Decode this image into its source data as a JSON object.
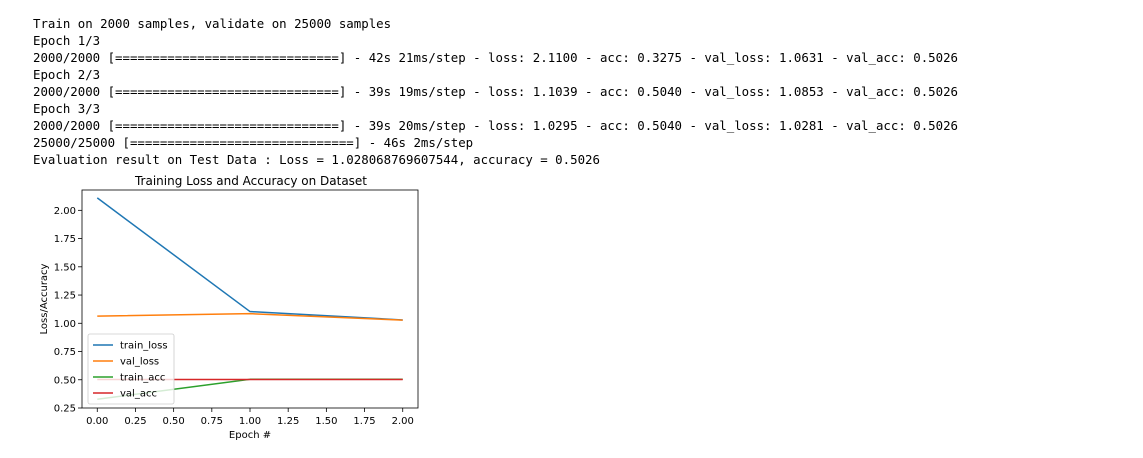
{
  "log": {
    "lines": [
      "Train on 2000 samples, validate on 25000 samples",
      "Epoch 1/3",
      "2000/2000 [==============================] - 42s 21ms/step - loss: 2.1100 - acc: 0.3275 - val_loss: 1.0631 - val_acc: 0.5026",
      "Epoch 2/3",
      "2000/2000 [==============================] - 39s 19ms/step - loss: 1.1039 - acc: 0.5040 - val_loss: 1.0853 - val_acc: 0.5026",
      "Epoch 3/3",
      "2000/2000 [==============================] - 39s 20ms/step - loss: 1.0295 - acc: 0.5040 - val_loss: 1.0281 - val_acc: 0.5026",
      "25000/25000 [==============================] - 46s 2ms/step",
      "Evaluation result on Test Data : Loss = 1.028068769607544, accuracy = 0.5026"
    ]
  },
  "chart_data": {
    "type": "line",
    "title": "Training Loss and Accuracy on Dataset",
    "xlabel": "Epoch #",
    "ylabel": "Loss/Accuracy",
    "x": [
      0,
      1,
      2
    ],
    "xlim": [
      -0.1,
      2.1
    ],
    "ylim": [
      0.25,
      2.18
    ],
    "xticks": [
      0.0,
      0.25,
      0.5,
      0.75,
      1.0,
      1.25,
      1.5,
      1.75,
      2.0
    ],
    "xtick_labels": [
      "0.00",
      "0.25",
      "0.50",
      "0.75",
      "1.00",
      "1.25",
      "1.50",
      "1.75",
      "2.00"
    ],
    "yticks": [
      0.25,
      0.5,
      0.75,
      1.0,
      1.25,
      1.5,
      1.75,
      2.0
    ],
    "ytick_labels": [
      "0.25",
      "0.50",
      "0.75",
      "1.00",
      "1.25",
      "1.50",
      "1.75",
      "2.00"
    ],
    "grid": false,
    "legend": "lower-left",
    "series": [
      {
        "name": "train_loss",
        "color": "#1f77b4",
        "values": [
          2.11,
          1.1039,
          1.0295
        ]
      },
      {
        "name": "val_loss",
        "color": "#ff7f0e",
        "values": [
          1.0631,
          1.0853,
          1.0281
        ]
      },
      {
        "name": "train_acc",
        "color": "#2ca02c",
        "values": [
          0.3275,
          0.504,
          0.504
        ]
      },
      {
        "name": "val_acc",
        "color": "#d62728",
        "values": [
          0.5026,
          0.5026,
          0.5026
        ]
      }
    ]
  }
}
